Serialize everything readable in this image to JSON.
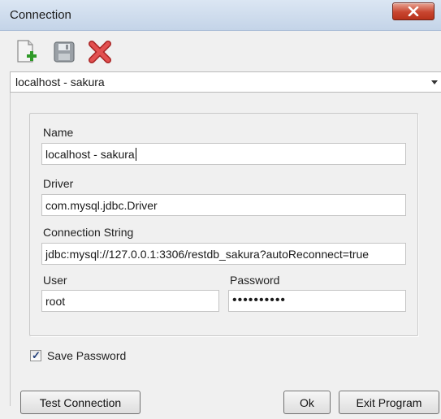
{
  "window": {
    "title": "Connection",
    "close_icon": "close-x-icon"
  },
  "toolbar": {
    "icons": [
      "new-document-icon",
      "save-icon",
      "delete-icon"
    ],
    "colors": {
      "new_accent": "#2f9a28",
      "delete": "#d73a3a"
    }
  },
  "connection_select": {
    "selected": "localhost - sakura"
  },
  "form": {
    "name_label": "Name",
    "name_value": "localhost - sakura",
    "driver_label": "Driver",
    "driver_value": "com.mysql.jdbc.Driver",
    "connstr_label": "Connection String",
    "connstr_value": "jdbc:mysql://127.0.0.1:3306/restdb_sakura?autoReconnect=true",
    "user_label": "User",
    "user_value": "root",
    "password_label": "Password",
    "password_value": "••••••••••"
  },
  "save_password": {
    "label": "Save Password",
    "checked": true
  },
  "buttons": {
    "test": "Test Connection",
    "ok": "Ok",
    "exit": "Exit Program"
  }
}
